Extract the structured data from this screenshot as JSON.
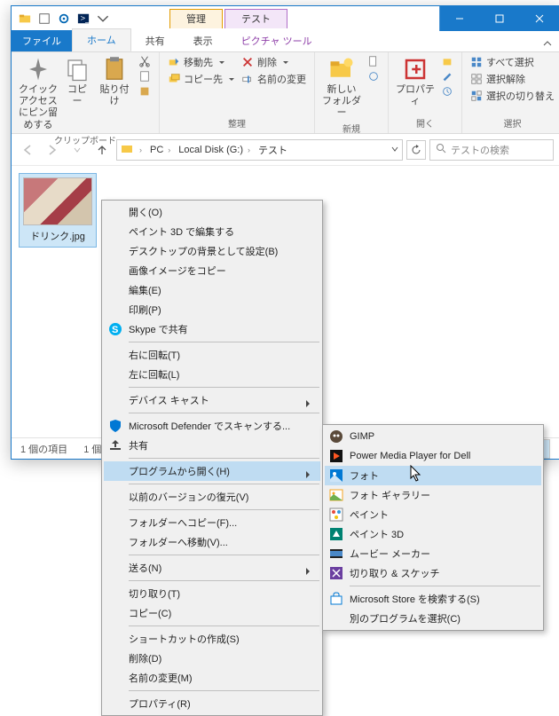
{
  "titlebar": {
    "contextual_tabs": [
      {
        "label": "管理"
      },
      {
        "label": "テスト"
      }
    ]
  },
  "ribbon": {
    "file_tab": "ファイル",
    "tabs": [
      "ホーム",
      "共有",
      "表示",
      "ピクチャ ツール"
    ],
    "groups": {
      "clipboard": {
        "pin": "クイック アクセス\nにピン留めする",
        "copy": "コピー",
        "paste": "貼り付け",
        "name": "クリップボード"
      },
      "organize": {
        "moveto": "移動先",
        "delete": "削除",
        "copyto": "コピー先",
        "rename": "名前の変更",
        "name": "整理"
      },
      "new": {
        "newfolder": "新しい\nフォルダー",
        "name": "新規"
      },
      "open": {
        "properties": "プロパティ",
        "name": "開く"
      },
      "select": {
        "selectall": "すべて選択",
        "selectnone": "選択解除",
        "invert": "選択の切り替え",
        "name": "選択"
      }
    }
  },
  "address": {
    "crumbs": [
      "PC",
      "Local Disk (G:)",
      "テスト"
    ]
  },
  "search": {
    "placeholder": "テストの検索"
  },
  "file": {
    "name": "ドリンク.jpg"
  },
  "status": {
    "items": "1 個の項目",
    "selected": "1 個"
  },
  "context1": {
    "items": [
      {
        "label": "開く(O)"
      },
      {
        "label": "ペイント 3D で編集する"
      },
      {
        "label": "デスクトップの背景として設定(B)"
      },
      {
        "label": "画像イメージをコピー"
      },
      {
        "label": "編集(E)"
      },
      {
        "label": "印刷(P)"
      },
      {
        "label": "Skype で共有",
        "icon": "skype"
      },
      {
        "sep": true
      },
      {
        "label": "右に回転(T)"
      },
      {
        "label": "左に回転(L)"
      },
      {
        "sep": true
      },
      {
        "label": "デバイス キャスト",
        "sub": true
      },
      {
        "sep": true
      },
      {
        "label": "Microsoft Defender でスキャンする...",
        "icon": "shield"
      },
      {
        "label": "共有",
        "icon": "share"
      },
      {
        "sep": true
      },
      {
        "label": "プログラムから開く(H)",
        "sub": true,
        "hov": true
      },
      {
        "sep": true
      },
      {
        "label": "以前のバージョンの復元(V)"
      },
      {
        "sep": true
      },
      {
        "label": "フォルダーへコピー(F)..."
      },
      {
        "label": "フォルダーへ移動(V)..."
      },
      {
        "sep": true
      },
      {
        "label": "送る(N)",
        "sub": true
      },
      {
        "sep": true
      },
      {
        "label": "切り取り(T)"
      },
      {
        "label": "コピー(C)"
      },
      {
        "sep": true
      },
      {
        "label": "ショートカットの作成(S)"
      },
      {
        "label": "削除(D)"
      },
      {
        "label": "名前の変更(M)"
      },
      {
        "sep": true
      },
      {
        "label": "プロパティ(R)"
      }
    ]
  },
  "context2": {
    "items": [
      {
        "label": "GIMP",
        "icon": "gimp"
      },
      {
        "label": "Power Media Player for Dell",
        "icon": "pmp"
      },
      {
        "label": "フォト",
        "icon": "photos",
        "hov": true
      },
      {
        "label": "フォト ギャラリー",
        "icon": "gallery"
      },
      {
        "label": "ペイント",
        "icon": "paint"
      },
      {
        "label": "ペイント 3D",
        "icon": "paint3d"
      },
      {
        "label": "ムービー メーカー",
        "icon": "movie"
      },
      {
        "label": "切り取り & スケッチ",
        "icon": "snip"
      },
      {
        "sep": true
      },
      {
        "label": "Microsoft Store を検索する(S)",
        "icon": "store"
      },
      {
        "label": "別のプログラムを選択(C)"
      }
    ]
  }
}
